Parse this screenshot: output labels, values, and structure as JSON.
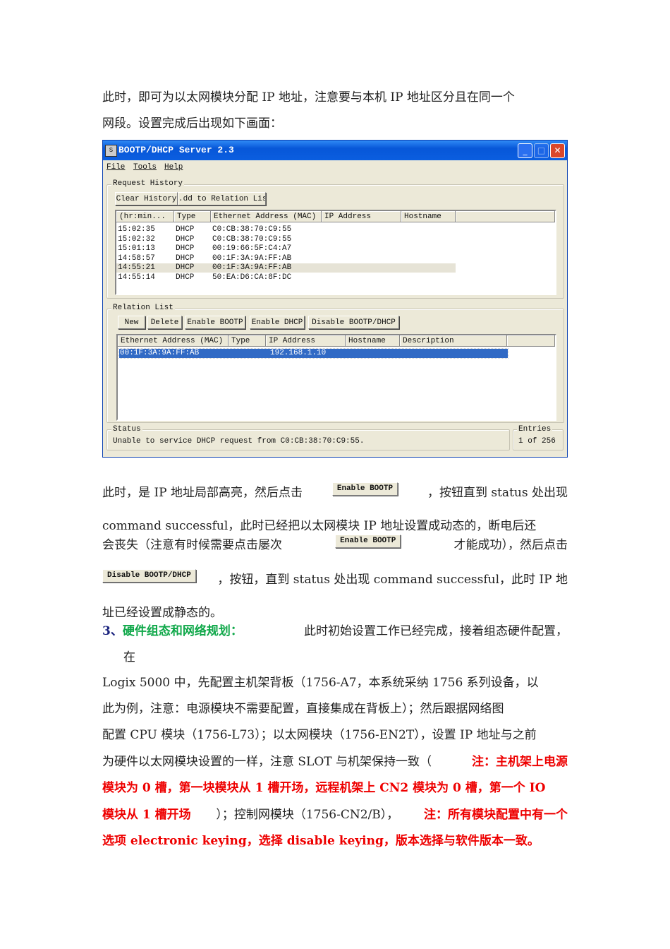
{
  "doc": {
    "p1_l1": "此时，即可为以太网模块分配 IP 地址，注意要与本机 IP 地址区分且在同一个",
    "p1_l2": "网段。设置完成后出现如下画面：",
    "l3a": "此时，是 IP 地址局部高亮，然后点击",
    "l3btn": "Enable BOOTP",
    "l3b": "，按钮直到 status 处出现",
    "l4": "command successful，此时已经把以太网模块 IP 地址设置成动态的，断电后还",
    "l5a": "会丧失（注意有时候需要点击屡次",
    "l5btn": "Enable BOOTP",
    "l5b": "才能成功），然后点击",
    "l6btn": "Disable BOOTP/DHCP",
    "l6b": "，按钮，直到 status 处出现 command successful，此时 IP 地",
    "l7": "址已经设置成静态的。",
    "h_num": "3、",
    "h_title": "硬件组态和网络规划：",
    "h_rest": "此时初始设置工作已经完成，接着组态硬件配置，",
    "l9": "在",
    "l10": "Logix 5000 中，先配置主机架背板（1756-A7，本系统采纳 1756 系列设备，以",
    "l11": "此为例，注意：电源模块不需要配置，直接集成在背板上）；然后跟据网络图",
    "l12": "配置 CPU 模块（1756-L73）；以太网模块（1756-EN2T），设置 IP 地址与之前",
    "l13a": "为硬件以太网模块设置的一样，注意 SLOT 与机架保持一致（",
    "l13b": "注：主机架上电源",
    "l14": "模块为 0 槽，第一块模块从 1 槽开场，远程机架上 CN2 模块为 0 槽，第一个 IO",
    "l15a": "模块从 1 槽开场",
    "l15b": "）；控制网模块（1756-CN2/B），",
    "l15c": "注：所有模块配置中有一个",
    "l16": "选项 electronic keying，选择 disable keying，版本选择与软件版本一致。"
  },
  "window": {
    "title": "BOOTP/DHCP Server 2.3",
    "menu": [
      "File",
      "Tools",
      "Help"
    ],
    "request_history": {
      "label": "Request History",
      "buttons": [
        "Clear History",
        ".dd to Relation Lis"
      ],
      "columns": [
        "(hr:min...",
        "Type",
        "Ethernet Address (MAC)",
        "IP Address",
        "Hostname"
      ],
      "rows": [
        [
          "15:02:35",
          "DHCP",
          "C0:CB:38:70:C9:55"
        ],
        [
          "15:02:32",
          "DHCP",
          "C0:CB:38:70:C9:55"
        ],
        [
          "15:01:13",
          "DHCP",
          "00:19:66:5F:C4:A7"
        ],
        [
          "14:58:57",
          "DHCP",
          "00:1F:3A:9A:FF:AB"
        ],
        [
          "14:55:21",
          "DHCP",
          "00:1F:3A:9A:FF:AB"
        ],
        [
          "14:55:14",
          "DHCP",
          "50:EA:D6:CA:8F:DC"
        ]
      ]
    },
    "relation_list": {
      "label": "Relation List",
      "buttons": [
        "New",
        "Delete",
        "Enable BOOTP",
        "Enable DHCP",
        "Disable BOOTP/DHCP"
      ],
      "columns": [
        "Ethernet Address (MAC)",
        "Type",
        "IP Address",
        "Hostname",
        "Description"
      ],
      "rows": [
        [
          "00:1F:3A:9A:FF:AB",
          "",
          "192.168.1.10",
          "",
          ""
        ]
      ]
    },
    "status": {
      "label": "Status",
      "text": "Unable to service DHCP request from C0:CB:38:70:C9:55."
    },
    "entries": {
      "label": "Entries",
      "text": "1 of 256"
    }
  }
}
